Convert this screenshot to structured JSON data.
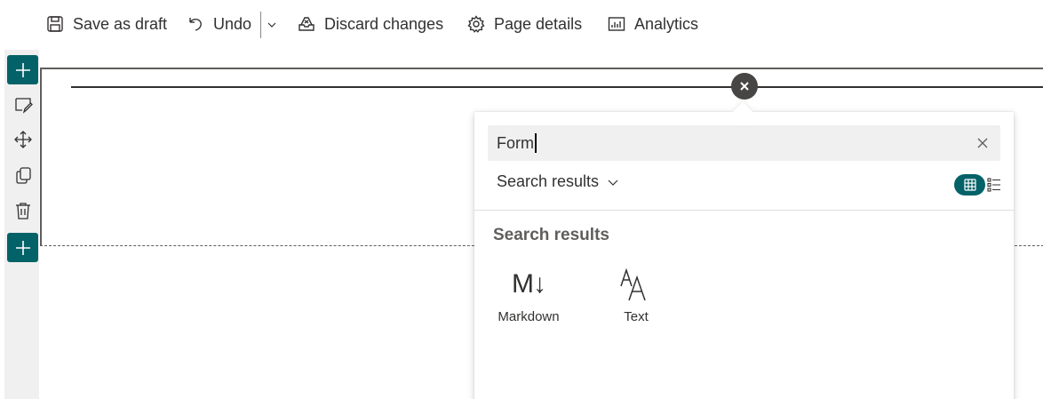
{
  "toolbar": {
    "save_draft": "Save as draft",
    "undo": "Undo",
    "discard": "Discard changes",
    "page_details": "Page details",
    "analytics": "Analytics"
  },
  "toolbox": {
    "search_value": "Form",
    "filter_label": "Search results",
    "results_heading": "Search results",
    "items": [
      {
        "label": "Markdown",
        "glyph": "M↓",
        "icon": "markdown-icon"
      },
      {
        "label": "Text",
        "glyph": "A",
        "icon": "text-icon"
      }
    ]
  },
  "colors": {
    "accent": "#036268",
    "close_button": "#484644"
  }
}
